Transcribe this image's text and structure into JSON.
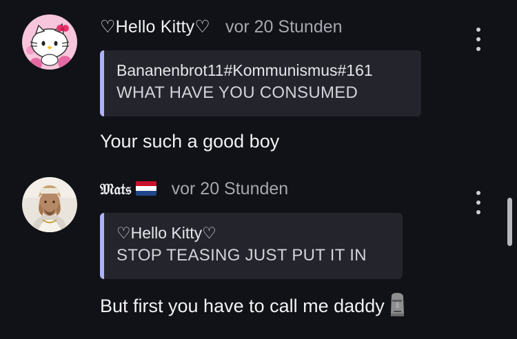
{
  "comments": [
    {
      "author": "♡Hello Kitty♡",
      "time": "vor 20 Stunden",
      "avatar_icon": "hello-kitty-avatar",
      "quote": {
        "author": "Bananenbrot11#Kommunismus#161",
        "text": "WHAT HAVE YOU CONSUMED"
      },
      "body": "Your such a good boy"
    },
    {
      "author": "𝔐𝔞𝔱𝔰",
      "author_flag": "netherlands-flag-icon",
      "time": "vor 20 Stunden",
      "avatar_icon": "user-photo-avatar",
      "quote": {
        "author": "♡Hello Kitty♡",
        "text": "STOP TEASING JUST PUT IT IN"
      },
      "body": "But first you have to call me daddy",
      "body_emoji": "moai-icon"
    }
  ],
  "colors": {
    "background": "#111217",
    "quote_bg": "#24252c",
    "quote_accent": "#aeb2ff",
    "muted_text": "#a7a7b0"
  }
}
